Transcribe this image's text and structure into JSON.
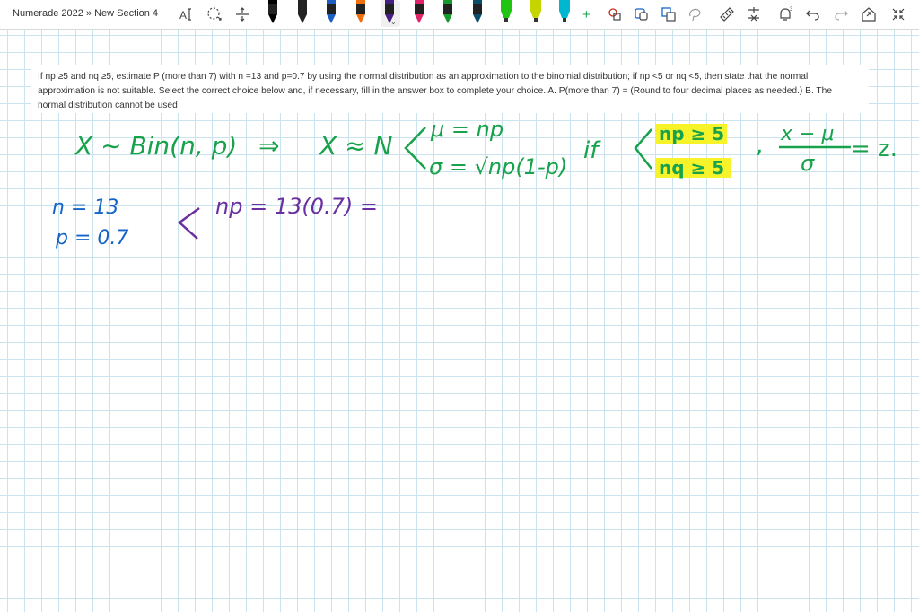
{
  "breadcrumb": "Numerade 2022 » New Section 4",
  "toolbar": {
    "icons": [
      "text-select-icon",
      "lasso-icon",
      "insert-space-icon",
      "pen-palette",
      "add-pen-icon",
      "ink-to-shape-icon",
      "ink-to-text-icon",
      "ink-to-math-icon",
      "lasso-select-icon",
      "ruler-icon",
      "math-icon",
      "notification-icon",
      "undo-icon",
      "redo-icon",
      "share-icon",
      "collapse-icon"
    ],
    "pen_colors": [
      "#000000",
      "#222222",
      "#1d5ec4",
      "#f06e0d",
      "#4a1f8c",
      "#e0246a",
      "#159a2e",
      "#0a4d6b",
      "#22c414",
      "#c6d400",
      "#00b7d0"
    ],
    "notification_count": "3",
    "add_symbol": "+"
  },
  "question": {
    "text": "If np ≥5 and nq ≥5, estimate P (more than 7) with n =13 and p=0.7 by using the normal distribution as an approximation to the binomial distribution; if np <5 or nq <5, then state that the normal approximation is not suitable. Select the correct choice below and, if necessary, fill in the answer box to complete your choice. A. P(more than 7) = (Round to four decimal places as needed.) B. The normal distribution cannot be used"
  },
  "handwriting": {
    "line1_left": "X ∼ Bin(n, p)",
    "arrow": "⇒",
    "approx": "X ≈ N",
    "mu": "μ = np",
    "sigma": "σ = √np(1-p)",
    "if_word": "if",
    "cond1": "np ≥ 5",
    "cond2": "nq ≥ 5",
    "z_num": "x − μ",
    "z_den": "σ",
    "z_eq": "= z.",
    "n_val": "n = 13",
    "p_val": "p = 0.7",
    "np_calc": "np = 13(0.7) ="
  },
  "colors": {
    "ink_green": "#17a24b",
    "ink_blue": "#1565c8",
    "ink_purple": "#6a2fa0",
    "highlight": "#f6f32a",
    "grid": "#c9e4ee"
  }
}
